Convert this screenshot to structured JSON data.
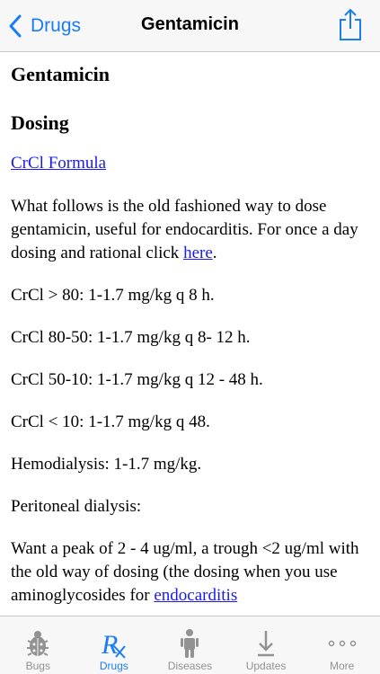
{
  "navbar": {
    "back_label": "Drugs",
    "title": "Gentamicin"
  },
  "content": {
    "heading": "Gentamicin",
    "section": "Dosing",
    "crcl_link": "CrCl Formula",
    "intro_text": "What follows is the old fashioned way to dose gentamicin, useful for endocarditis. For once a day dosing and rational click ",
    "intro_link": "here",
    "intro_end": ".",
    "doses": [
      "CrCl > 80: 1-1.7 mg/kg q 8 h.",
      "CrCl 80-50: 1-1.7 mg/kg q 8- 12 h.",
      "CrCl 50-10: 1-1.7 mg/kg q 12 - 48 h.",
      "CrCl < 10: 1-1.7 mg/kg q 48.",
      "Hemodialysis: 1-1.7 mg/kg.",
      "Peritoneal dialysis:"
    ],
    "peak_text": "Want a peak of 2 - 4 ug/ml, a trough <2 ug/ml with the old way of dosing (the dosing when you use aminoglycosides for ",
    "peak_link": "endocarditis"
  },
  "tabbar": {
    "tabs": [
      {
        "label": "Bugs",
        "icon": "bug-icon"
      },
      {
        "label": "Drugs",
        "icon": "rx-icon"
      },
      {
        "label": "Diseases",
        "icon": "person-icon"
      },
      {
        "label": "Updates",
        "icon": "download-arrow-icon"
      },
      {
        "label": "More",
        "icon": "more-dots-icon"
      }
    ],
    "active": "Drugs"
  },
  "colors": {
    "accent": "#1a7cf5",
    "link": "#1a1aee",
    "tab_inactive": "#929292",
    "bar_background": "#f7f7f8"
  }
}
